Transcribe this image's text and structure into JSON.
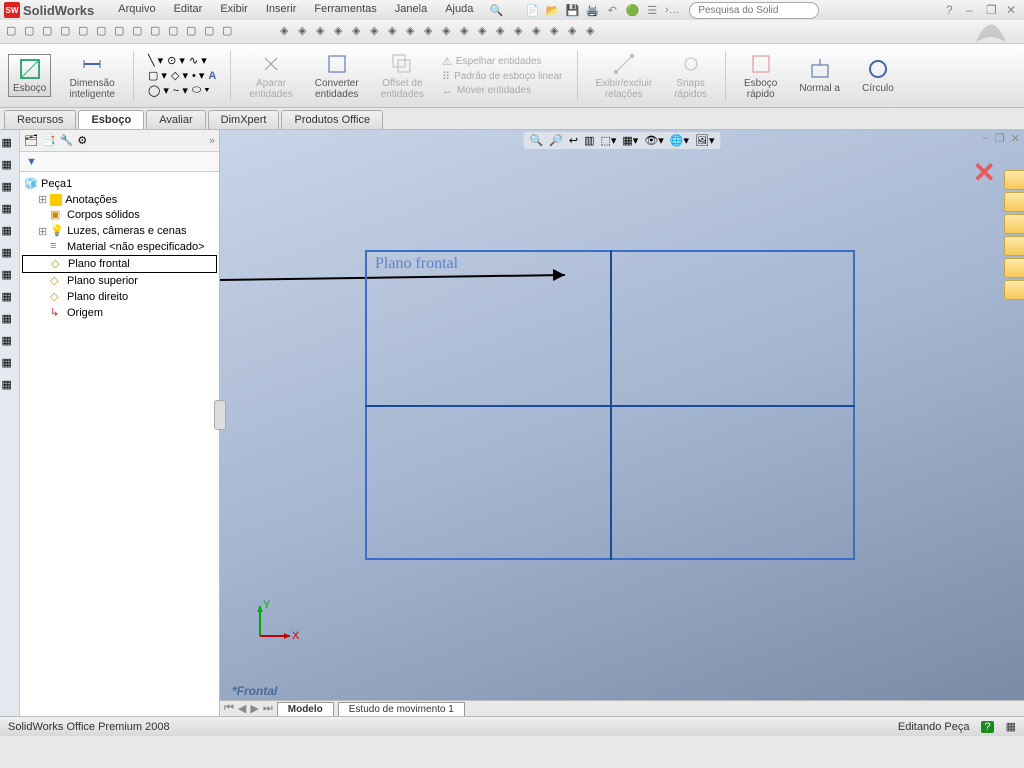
{
  "app": {
    "title": "SolidWorks"
  },
  "menu": [
    "Arquivo",
    "Editar",
    "Exibir",
    "Inserir",
    "Ferramentas",
    "Janela",
    "Ajuda"
  ],
  "search": {
    "placeholder": "Pesquisa do Solid"
  },
  "ribbon": {
    "esboco": "Esboço",
    "dimensao": "Dimensão\ninteligente",
    "aparar": "Aparar\nentidades",
    "converter": "Converter\nentidades",
    "offset": "Offset de\nentidades",
    "espelhar": "Espelhar entidades",
    "padrao": "Padrão de esboço linear",
    "mover": "Mover entidades",
    "exibir": "Exibir/excluir\nrelações",
    "snaps": "Snaps\nrápidos",
    "rapido": "Esboço\nrápido",
    "normal": "Normal a",
    "circulo": "Círculo"
  },
  "tabs": [
    "Recursos",
    "Esboço",
    "Avaliar",
    "DimXpert",
    "Produtos Office"
  ],
  "tree": {
    "root": "Peça1",
    "items": [
      "Anotações",
      "Corpos sólidos",
      "Luzes, câmeras e cenas",
      "Material <não especificado>",
      "Plano frontal",
      "Plano superior",
      "Plano direito",
      "Origem"
    ]
  },
  "viewport": {
    "planeLabel": "Plano frontal",
    "statusView": "*Frontal"
  },
  "bottomTabs": [
    "Modelo",
    "Estudo de movimento 1"
  ],
  "statusbar": {
    "left": "SolidWorks Office Premium 2008",
    "right": "Editando Peça"
  }
}
